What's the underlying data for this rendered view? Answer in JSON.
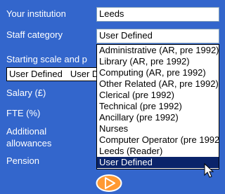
{
  "form": {
    "institution_label": "Your institution",
    "institution_value": "Leeds",
    "staff_category_label": "Staff category",
    "staff_category_value": "User Defined",
    "starting_scale_label": "Starting scale and p",
    "starting_scale_cells": [
      "User Defined",
      "User D"
    ],
    "salary_label": "Salary (£)",
    "fte_label": "FTE (%)",
    "allowances_label_line1": "Additional",
    "allowances_label_line2": "allowances",
    "pension_label": "Pension"
  },
  "dropdown": {
    "options": [
      "Administrative (AR, pre 1992)",
      "Library (AR, pre 1992)",
      "Computing (AR, pre 1992)",
      "Other Related (AR, pre 1992)",
      "Clerical (pre 1992)",
      "Technical (pre 1992)",
      "Ancillary (pre 1992)",
      "Nurses",
      "Computer Operator (pre 1992)",
      "Leeds (Reader)",
      "User Defined"
    ],
    "selected_index": 10
  },
  "icons": {
    "submit": "play-arrow-icon",
    "cursor": "mouse-pointer-icon"
  },
  "colors": {
    "background": "#3366cc",
    "selection": "#0a246a",
    "button_fill": "#ff9933"
  }
}
